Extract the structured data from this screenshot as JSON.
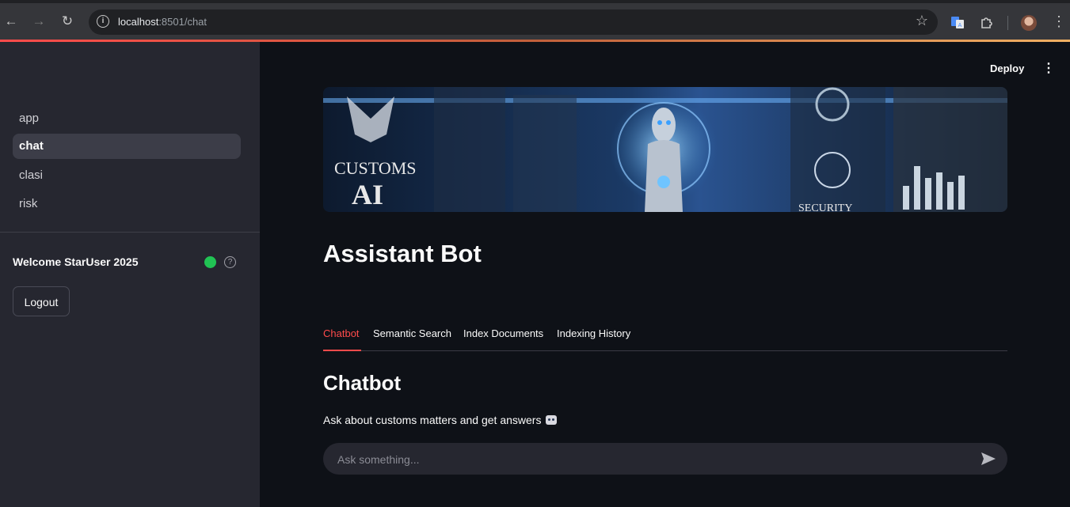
{
  "browser": {
    "url_host": "localhost",
    "url_path": ":8501/chat"
  },
  "sidebar": {
    "items": [
      {
        "label": "app",
        "active": false
      },
      {
        "label": "chat",
        "active": true
      },
      {
        "label": "clasi",
        "active": false
      },
      {
        "label": "risk",
        "active": false
      }
    ],
    "welcome": "Welcome StarUser 2025",
    "status_color": "#21c354",
    "logout_label": "Logout"
  },
  "header": {
    "deploy_label": "Deploy",
    "menu_icon": "kebab-menu-icon"
  },
  "banner": {
    "text_line1": "CUSTOMS",
    "text_line2": "AI",
    "side_text": "SECURITY"
  },
  "main": {
    "title": "Assistant Bot",
    "tabs": [
      {
        "label": "Chatbot",
        "active": true
      },
      {
        "label": "Semantic Search",
        "active": false
      },
      {
        "label": "Index Documents",
        "active": false
      },
      {
        "label": "Indexing History",
        "active": false
      }
    ],
    "section_title": "Chatbot",
    "caption": "Ask about customs matters and get answers",
    "chat_placeholder": "Ask something..."
  },
  "colors": {
    "accent": "#ff4b4b",
    "background": "#0e1117",
    "sidebar": "#262730"
  }
}
